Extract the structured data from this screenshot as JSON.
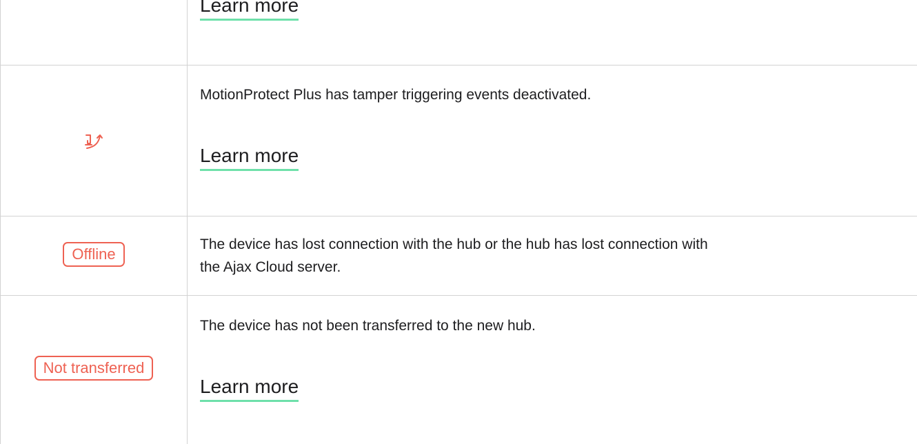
{
  "colors": {
    "accent_red": "#ee6152",
    "link_underline": "#6ee0aa",
    "grid_line": "#d2d2d2",
    "text": "#1d1d1f"
  },
  "rows": [
    {
      "link_label": "Learn more"
    },
    {
      "icon": "tamper-deactivated-icon",
      "description": "MotionProtect Plus has tamper triggering events deactivated.",
      "link_label": "Learn more"
    },
    {
      "badge": "Offline",
      "description_lines": [
        "The device has lost connection with the hub or the hub has lost connection with",
        "the Ajax Cloud server."
      ]
    },
    {
      "badge": "Not transferred",
      "description": "The device has not been transferred to the new hub.",
      "link_label": "Learn more"
    }
  ]
}
